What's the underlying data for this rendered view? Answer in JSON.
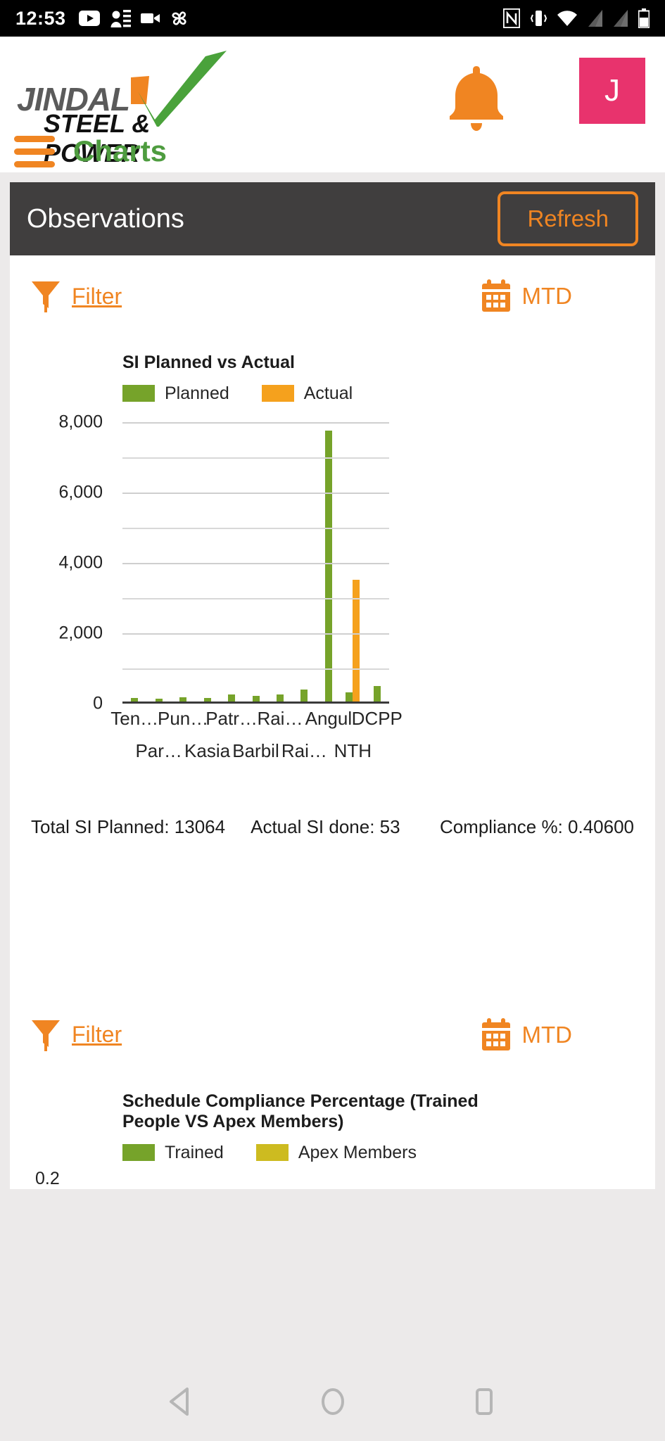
{
  "statusbar": {
    "time": "12:53",
    "left_icons": [
      "youtube-icon",
      "contacts-sync-icon",
      "video-camera-icon",
      "fan-icon"
    ],
    "right_icons": [
      "nfc-icon",
      "vibrate-icon",
      "wifi-icon",
      "signal-1-icon",
      "signal-2-icon",
      "battery-icon"
    ]
  },
  "header": {
    "logo_line1": "JINDAL",
    "logo_line2": "STEEL & POWER",
    "notification_icon": "bell-icon",
    "avatar_initial": "J",
    "avatar_color": "#e8336d",
    "menu_icon": "hamburger-icon",
    "page_title": "Charts",
    "title_color": "#4e9c3f",
    "accent_color": "#f08522"
  },
  "observations": {
    "title": "Observations",
    "refresh_label": "Refresh"
  },
  "filter_bar_1": {
    "filter_icon": "funnel-icon",
    "filter_label": "Filter",
    "calendar_icon": "calendar-icon",
    "range_label": "MTD"
  },
  "filter_bar_2": {
    "filter_icon": "funnel-icon",
    "filter_label": "Filter",
    "calendar_icon": "calendar-icon",
    "range_label": "MTD"
  },
  "totals": {
    "planned_label": "Total SI Planned: 13064",
    "actual_label": "Actual SI done: 53",
    "compliance_label": "Compliance %:  0.40600"
  },
  "navbar": {
    "back": "back-triangle-icon",
    "home": "home-circle-icon",
    "recents": "recents-square-icon"
  },
  "chart_data": [
    {
      "type": "bar",
      "title": "SI Planned vs Actual",
      "xlabel": "",
      "ylabel": "",
      "ylim": [
        0,
        8000
      ],
      "yticks": [
        0,
        2000,
        4000,
        6000,
        8000
      ],
      "ytick_labels": [
        "0",
        "2,000",
        "4,000",
        "6,000",
        "8,000"
      ],
      "minor_gridlines": true,
      "grid": true,
      "legend_position": "top-left",
      "legend": [
        "Planned",
        "Actual"
      ],
      "colors": [
        "#76a32a",
        "#f5a11d"
      ],
      "categories": [
        "Ten…",
        "Par…",
        "Pun…",
        "Kasia",
        "Patr…",
        "Barbil",
        "Rai…",
        "Rai…",
        "Angul",
        "NTH",
        "DCPP"
      ],
      "category_rows": [
        0,
        1,
        0,
        1,
        0,
        1,
        0,
        1,
        0,
        1,
        0
      ],
      "series": [
        {
          "name": "Planned",
          "values": [
            95,
            70,
            120,
            90,
            200,
            150,
            190,
            330,
            7700,
            250,
            430
          ]
        },
        {
          "name": "Actual",
          "values": [
            0,
            0,
            0,
            0,
            0,
            0,
            0,
            0,
            0,
            3450,
            0
          ]
        }
      ]
    },
    {
      "type": "bar",
      "title": "Schedule Compliance Percentage (Trained People VS Apex Members)",
      "legend": [
        "Trained",
        "Apex Members"
      ],
      "colors": [
        "#76a32a",
        "#cdbb20"
      ],
      "ytick_labels": [
        "0.2"
      ],
      "categories": [],
      "series": [
        {
          "name": "Trained",
          "values": []
        },
        {
          "name": "Apex Members",
          "values": []
        }
      ]
    }
  ]
}
